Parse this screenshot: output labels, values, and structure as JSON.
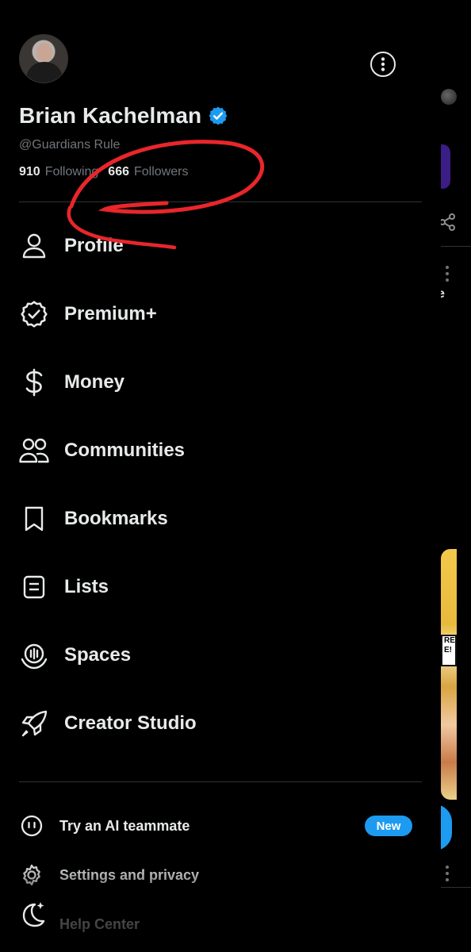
{
  "profile": {
    "display_name": "Brian Kachelman",
    "handle": "@Guardians Rule",
    "following_count": "910",
    "following_label": "Following",
    "followers_count": "666",
    "followers_label": "Followers"
  },
  "menu": {
    "items": [
      {
        "label": "Profile",
        "icon": "person-icon"
      },
      {
        "label": "Premium+",
        "icon": "verified-badge-icon"
      },
      {
        "label": "Money",
        "icon": "dollar-icon"
      },
      {
        "label": "Communities",
        "icon": "people-icon"
      },
      {
        "label": "Bookmarks",
        "icon": "bookmark-icon"
      },
      {
        "label": "Lists",
        "icon": "list-icon"
      },
      {
        "label": "Spaces",
        "icon": "spaces-icon"
      },
      {
        "label": "Creator Studio",
        "icon": "rocket-icon"
      }
    ]
  },
  "bottom": {
    "ai_label": "Try an AI teammate",
    "ai_badge": "New",
    "settings_label": "Settings and privacy",
    "help_label": "Help Center"
  },
  "colors": {
    "accent": "#1d9bf0",
    "annotation": "#e8262b",
    "secondary_text": "#71767b"
  }
}
